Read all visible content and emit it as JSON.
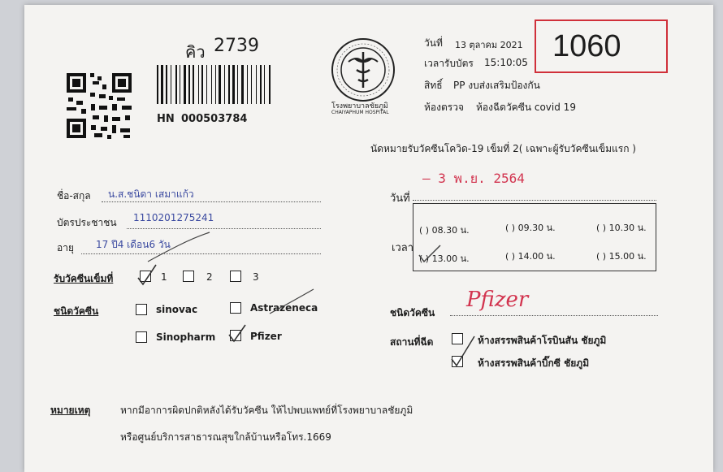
{
  "queue": {
    "label": "คิว",
    "number": "2739"
  },
  "hn": {
    "label": "HN",
    "value": "000503784"
  },
  "hospital_logo_text": {
    "top": "กระทรวงสาธารณสุข",
    "bottom": "MINISTRY OF PUBLIC HEALTH",
    "name_th": "โรงพยาบาลชัยภูมิ",
    "name_en": "CHAIYAPHUM HOSPITAL"
  },
  "header": {
    "date_label": "วันที่",
    "date_value": "13 ตุลาคม 2021",
    "time_label": "เวลารับบัตร",
    "time_value": "15:10:05",
    "right_label": "สิทธิ์",
    "right_value": "PP งบส่งเสริมป้องกัน",
    "room_label": "ห้องตรวจ",
    "room_value": "ห้องฉีดวัคซีน covid 19"
  },
  "ticket_number": "1060",
  "appointment_title": "นัดหมายรับวัคซีนโควิด-19 เข็มที่ 2( เฉพาะผู้รับวัคซีนเข็มแรก )",
  "patient": {
    "name_label": "ชื่อ-สกุล",
    "name_value": "น.ส.ชนิดา เสมาแก้ว",
    "id_label": "บัตรประชาชน",
    "id_value": "1110201275241",
    "age_label": "อายุ",
    "age_value": "17 ปี4 เดือน6 วัน"
  },
  "dose": {
    "label": "รับวัคซีนเข็มที่",
    "options": [
      "1",
      "2",
      "3"
    ],
    "checked": "1"
  },
  "vaccine": {
    "label": "ชนิดวัคซีน",
    "options": [
      "sinovac",
      "Astrazeneca",
      "Sinopharm",
      "Pfizer"
    ],
    "checked": "Pfizer"
  },
  "appointment": {
    "date_label": "วันที่",
    "date_value": "– 3 พ.ย. 2564",
    "time_label": "เวลา",
    "slots": [
      "( ) 08.30 น.",
      "( ) 09.30 น.",
      "( ) 10.30 น.",
      "( ) 13.00 น.",
      "( ) 14.00 น.",
      "( ) 15.00 น."
    ],
    "selected_slot": "13.00 น.",
    "vaccine_label": "ชนิดวัคซีน",
    "vaccine_value": "Pfizer",
    "place_label": "สถานที่ฉีด",
    "places": [
      "ห้างสรรพสินค้าโรบินสัน ชัยภูมิ",
      "ห้างสรรพสินค้าบิ๊กซี ชัยภูมิ"
    ],
    "selected_place": "ห้างสรรพสินค้าบิ๊กซี ชัยภูมิ"
  },
  "note": {
    "label": "หมายเหตุ",
    "line1": "หากมีอาการผิดปกติหลังได้รับวัคซีน ให้ไปพบแพทย์ที่โรงพยาบาลชัยภูมิ",
    "line2": "หรือศูนย์บริการสาธารณสุขใกล้บ้านหรือโทร.1669"
  }
}
